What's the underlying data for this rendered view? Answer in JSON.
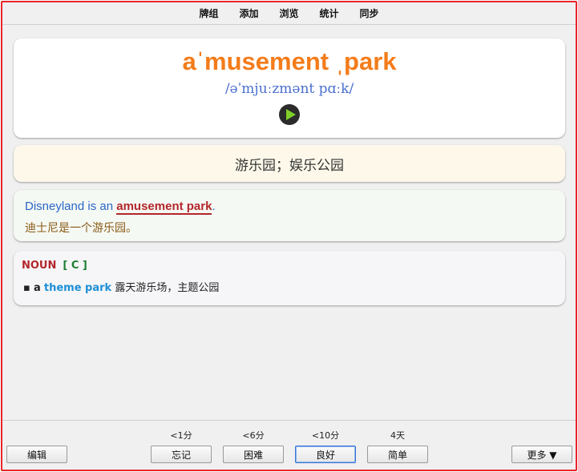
{
  "menu": {
    "decks": "牌组",
    "add": "添加",
    "browse": "浏览",
    "stats": "统计",
    "sync": "同步"
  },
  "card": {
    "word": "aˈmusement ˌpark",
    "phonetic": "/əˈmjuːzmənt pɑːk/",
    "definition": "游乐园；娱乐公园",
    "example_prefix": "Disneyland is an ",
    "example_highlight": "amusement park",
    "example_suffix": ".",
    "example_translation": "迪士尼是一个游乐园。",
    "pos": "NOUN",
    "countability": "[ C ]",
    "collocation_a": "a",
    "collocation_term": "theme park",
    "collocation_meaning": "露天游乐场，主题公园"
  },
  "answer": {
    "edit_label": "编辑",
    "more_label": "更多 ▼",
    "buttons": [
      {
        "label": "忘记",
        "interval": "<1分"
      },
      {
        "label": "困难",
        "interval": "<6分"
      },
      {
        "label": "良好",
        "interval": "<10分"
      },
      {
        "label": "简单",
        "interval": "4天"
      }
    ]
  },
  "colors": {
    "word": "#f47c1a",
    "phonetic": "#4a6fcf",
    "highlight": "#b3262b",
    "collocation": "#1e8fd6",
    "border": "#e8262b"
  },
  "icons": {
    "play": "play-audio-icon"
  }
}
